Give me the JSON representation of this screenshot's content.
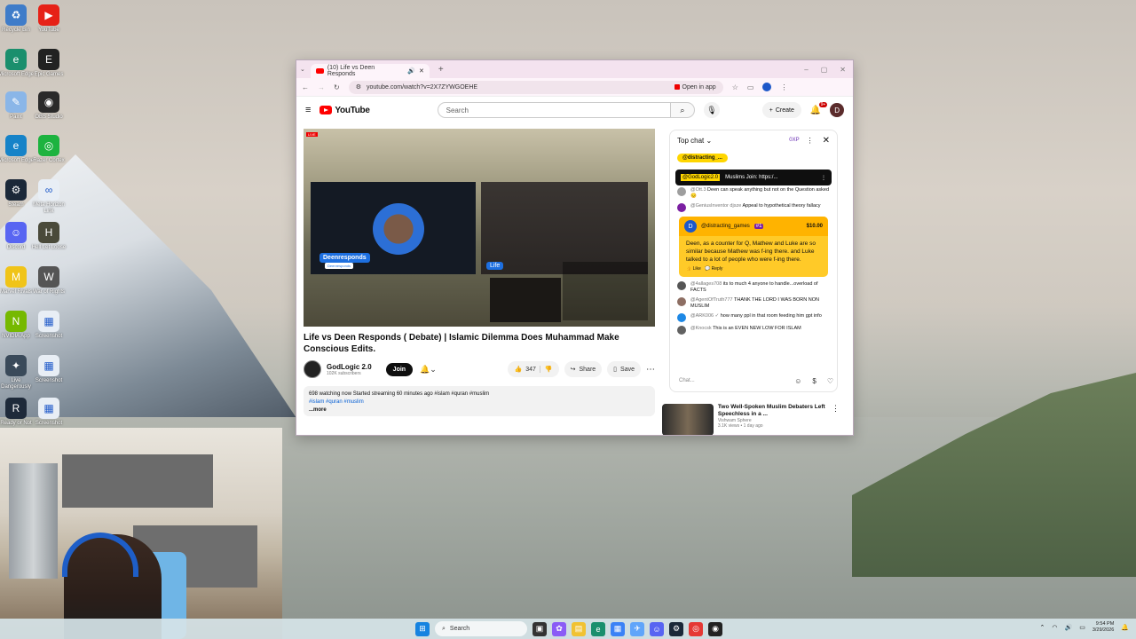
{
  "desktop": {
    "icons": [
      {
        "label": "Recycle Bin",
        "color": "#3f7cc9",
        "glyph": "♻"
      },
      {
        "label": "YouTube",
        "color": "#e62117",
        "glyph": "▶"
      },
      {
        "label": "Microsoft Edge",
        "color": "#1a8f6d",
        "glyph": "e"
      },
      {
        "label": "Epic Games",
        "color": "#222222",
        "glyph": "E"
      },
      {
        "label": "Paint",
        "color": "#8ab6e8",
        "glyph": "✎"
      },
      {
        "label": "OBS Studio",
        "color": "#2a2a2a",
        "glyph": "◉"
      },
      {
        "label": "Microsoft Edge",
        "color": "#1683c8",
        "glyph": "e"
      },
      {
        "label": "Razer Cortex",
        "color": "#1db33f",
        "glyph": "◎"
      },
      {
        "label": "Steam",
        "color": "#1b2838",
        "glyph": "⚙"
      },
      {
        "label": "Meta Horizon Link",
        "color": "#e8eef5",
        "glyph": "∞"
      },
      {
        "label": "Discord",
        "color": "#5865f2",
        "glyph": "☺"
      },
      {
        "label": "Hell Let Loose",
        "color": "#4a4a3a",
        "glyph": "H"
      },
      {
        "label": "Marvel Rivals",
        "color": "#f0c419",
        "glyph": "M"
      },
      {
        "label": "War of Rights",
        "color": "#555555",
        "glyph": "W"
      },
      {
        "label": "NVIDIA App",
        "color": "#76b900",
        "glyph": "N"
      },
      {
        "label": "Screenshot",
        "color": "#e8eef5",
        "glyph": "▦"
      },
      {
        "label": "Live Dangerously",
        "color": "#3a4a5a",
        "glyph": "✦"
      },
      {
        "label": "Screenshot",
        "color": "#e8eef5",
        "glyph": "▦"
      },
      {
        "label": "Ready or Not",
        "color": "#1e2a3a",
        "glyph": "R"
      },
      {
        "label": "Screenshot",
        "color": "#e8eef5",
        "glyph": "▦"
      }
    ]
  },
  "browser": {
    "tab_title": "(10) Life vs Deen Responds",
    "url": "youtube.com/watch?v=2X7ZYWGOEHE",
    "open_in_app": "Open in app"
  },
  "youtube": {
    "logo": "YouTube",
    "search_placeholder": "Search",
    "create": "Create",
    "notif_count": "9+",
    "avatar_letter": "D",
    "video": {
      "live_badge": "LIVE",
      "host_tag": "Deenresponds",
      "host_sub": "Deenresponds",
      "guest_tag": "Life"
    },
    "title": "Life vs Deen Responds ( Debate) | Islamic Dilemma Does Muhammad Make Conscious Edits.",
    "channel": {
      "name": "GodLogic 2.0",
      "subs": "102K subscribers"
    },
    "join": "Join",
    "likes": "347",
    "share": "Share",
    "save": "Save",
    "desc_line1": "698 watching now  Started streaming 60 minutes ago  #islam #quran #muslim",
    "desc_tags": "#islam #quran #muslim",
    "desc_more": "...more"
  },
  "chat": {
    "header": "Top chat",
    "xp": "0XP",
    "pinned": "@distracting_...",
    "banner_user": "@GodLogic2.0",
    "banner_text": "Muslims Join: https:/...",
    "messages_top": [
      {
        "author": "@Ott.3",
        "text": "Deen can speak anything but not on the Question asked 😔",
        "color": "#9e9e9e"
      },
      {
        "author": "@GeniusInventor djsze",
        "text": "Appeal to hypothetical theory fallacy",
        "color": "#7b1fa2"
      }
    ],
    "superchat": {
      "user": "@distracting_games",
      "rank": "#1",
      "amount": "$10.00",
      "text": "Deen, as a counter for Q, Mathew and Luke are so similar because Mathew was f-ing there. and Luke talked to a lot of people who were f-ing there.",
      "like": "Like",
      "reply": "Reply"
    },
    "messages_bottom": [
      {
        "author": "@4allages708",
        "text": "its to much 4 anyone to handle...overload of FACTS",
        "color": "#555555"
      },
      {
        "author": "@AgentOfTruth777",
        "text": "THANK THE LORD I WAS BORN NON MUSLIM",
        "color": "#8d6e63"
      },
      {
        "author": "@ARK006 ✓",
        "text": "how many ppl in that room feeding him gpt info",
        "color": "#1e88e5"
      },
      {
        "author": "@Knocsk",
        "text": "This is an EVEN NEW LOW FOR ISLAM",
        "color": "#616161"
      }
    ],
    "input_placeholder": "Chat..."
  },
  "recommended": {
    "title": "Two Well-Spoken Muslim Debaters Left Speechless in a ...",
    "channel": "Vishwam Sphere",
    "meta": "3.1K views • 1 day ago"
  },
  "taskbar": {
    "search": "Search",
    "time": "9:54 PM",
    "date": "3/29/2026"
  }
}
